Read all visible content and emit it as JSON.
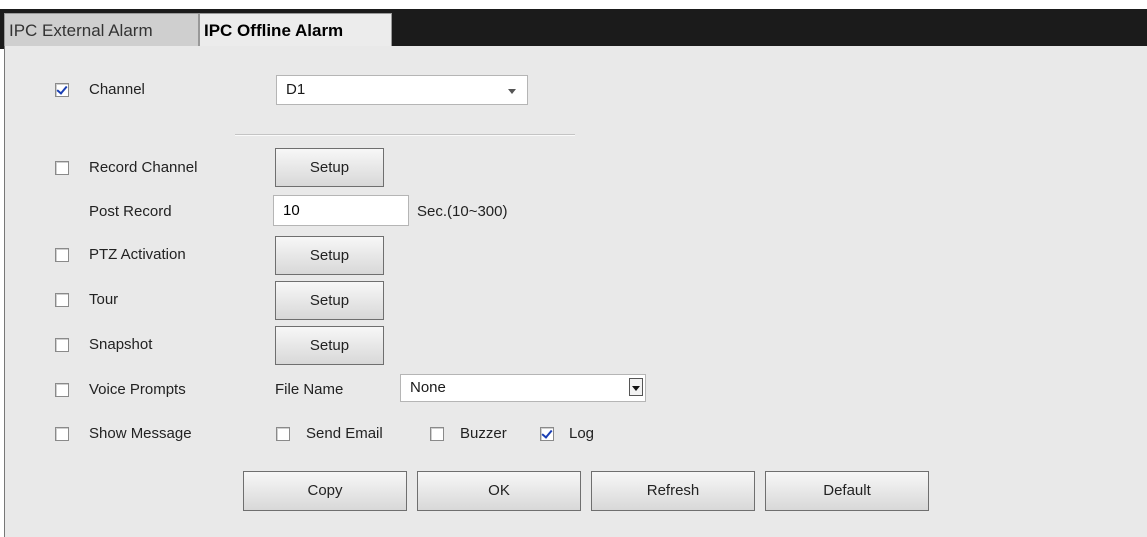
{
  "tabs": {
    "external": "IPC External Alarm",
    "offline": "IPC Offline Alarm"
  },
  "form": {
    "channel": {
      "label": "Channel",
      "checked": true,
      "value": "D1"
    },
    "record_channel": {
      "label": "Record Channel",
      "checked": false,
      "button": "Setup"
    },
    "post_record": {
      "label": "Post Record",
      "value": "10",
      "unit": "Sec.(10~300)"
    },
    "ptz_activation": {
      "label": "PTZ Activation",
      "checked": false,
      "button": "Setup"
    },
    "tour": {
      "label": "Tour",
      "checked": false,
      "button": "Setup"
    },
    "snapshot": {
      "label": "Snapshot",
      "checked": false,
      "button": "Setup"
    },
    "voice_prompts": {
      "label": "Voice Prompts",
      "checked": false,
      "file_label": "File Name",
      "file_value": "None"
    },
    "show_message": {
      "label": "Show Message",
      "checked": false
    },
    "send_email": {
      "label": "Send Email",
      "checked": false
    },
    "buzzer": {
      "label": "Buzzer",
      "checked": false
    },
    "log": {
      "label": "Log",
      "checked": true
    }
  },
  "buttons": {
    "copy": "Copy",
    "ok": "OK",
    "refresh": "Refresh",
    "default": "Default"
  },
  "icons": {
    "checkbox_check": "checkmark-icon",
    "dropdown": "chevron-down-icon"
  },
  "colors": {
    "topbar": "#1b1b1b",
    "panel": "#e9e9e9",
    "check": "#1a3fb4"
  }
}
